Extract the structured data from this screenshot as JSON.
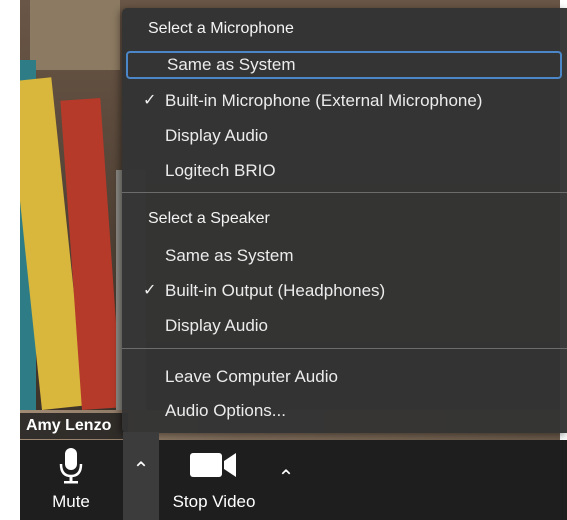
{
  "participant": {
    "name": "Amy Lenzo"
  },
  "audio_menu": {
    "microphone_section": {
      "title": "Select a Microphone",
      "items": [
        {
          "label": "Same as System",
          "checked": false,
          "focused": true
        },
        {
          "label": "Built-in Microphone (External Microphone)",
          "checked": true,
          "focused": false
        },
        {
          "label": "Display Audio",
          "checked": false,
          "focused": false
        },
        {
          "label": "Logitech BRIO",
          "checked": false,
          "focused": false
        }
      ]
    },
    "speaker_section": {
      "title": "Select a Speaker",
      "items": [
        {
          "label": "Same as System",
          "checked": false
        },
        {
          "label": "Built-in Output (Headphones)",
          "checked": true
        },
        {
          "label": "Display Audio",
          "checked": false
        }
      ]
    },
    "actions": [
      {
        "label": "Leave Computer Audio"
      },
      {
        "label": "Audio Options..."
      }
    ],
    "check_glyph": "✓"
  },
  "toolbar": {
    "mute_label": "Mute",
    "mute_icon": "microphone-icon",
    "audio_caret_icon": "chevron-up-icon",
    "stop_video_label": "Stop Video",
    "video_icon": "video-camera-icon",
    "video_caret_icon": "chevron-up-icon",
    "caret_glyph": "⌃"
  },
  "colors": {
    "menu_bg": "#343434",
    "focus_ring": "#4a86c8",
    "toolbar_bg": "#1e1e1e",
    "active_caret_bg": "#3c3c3c"
  }
}
